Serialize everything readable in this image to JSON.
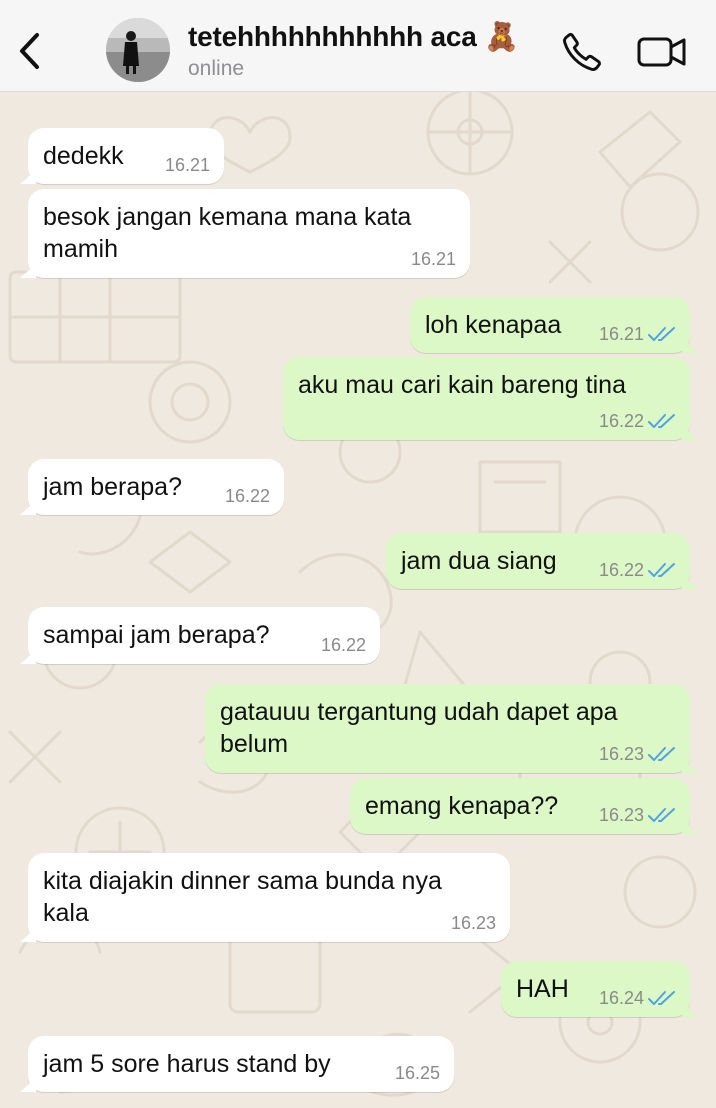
{
  "header": {
    "contact_name": "tetehhhhhhhhhhh aca 🧸",
    "status": "online"
  },
  "colors": {
    "incoming_bubble": "#ffffff",
    "outgoing_bubble": "#dcf8c6",
    "read_ticks": "#4fa3e0",
    "wallpaper": "#efe9df"
  },
  "messages": [
    {
      "dir": "in",
      "text": "dedekk",
      "time": "16.21"
    },
    {
      "dir": "in",
      "text": "besok jangan kemana mana kata\nmamih",
      "time": "16.21"
    },
    {
      "dir": "out",
      "text": "loh kenapaa",
      "time": "16.21",
      "status": "read"
    },
    {
      "dir": "out",
      "text": "aku mau cari kain bareng tina",
      "time": "16.22",
      "status": "read"
    },
    {
      "dir": "in",
      "text": "jam berapa?",
      "time": "16.22"
    },
    {
      "dir": "out",
      "text": "jam dua siang",
      "time": "16.22",
      "status": "read"
    },
    {
      "dir": "in",
      "text": "sampai jam berapa?",
      "time": "16.22"
    },
    {
      "dir": "out",
      "text": "gatauuu tergantung udah dapet apa\nbelum",
      "time": "16.23",
      "status": "read"
    },
    {
      "dir": "out",
      "text": "emang kenapa??",
      "time": "16.23",
      "status": "read"
    },
    {
      "dir": "in",
      "text": "kita diajakin dinner sama bunda nya\nkala",
      "time": "16.23"
    },
    {
      "dir": "out",
      "text": "HAH",
      "time": "16.24",
      "status": "read"
    },
    {
      "dir": "in",
      "text": "jam 5 sore harus stand by",
      "time": "16.25"
    }
  ]
}
